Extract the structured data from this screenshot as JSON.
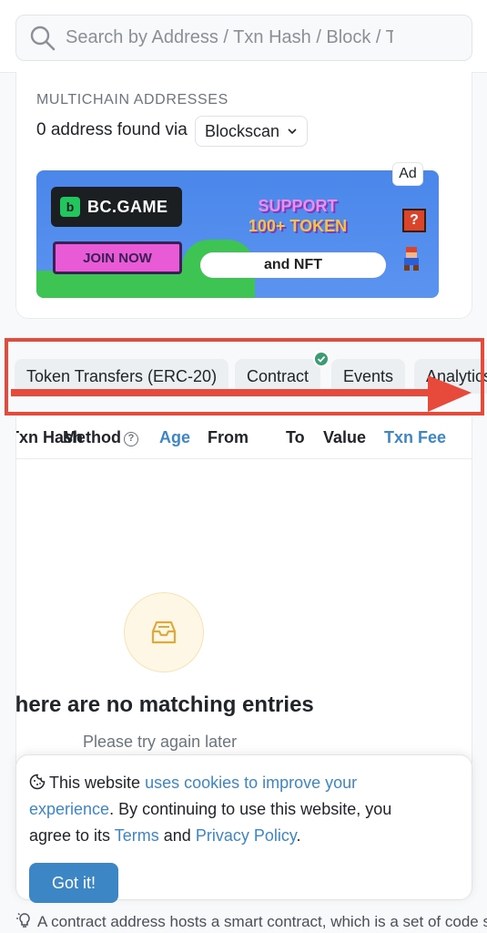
{
  "search": {
    "placeholder": "Search by Address / Txn Hash / Block / Token / Domain Name"
  },
  "multichain": {
    "label": "MULTICHAIN ADDRESSES",
    "found_text": "0 address found via",
    "select_value": "Blockscan"
  },
  "ad": {
    "badge": "Ad",
    "brand": "BC.GAME",
    "join": "JOIN NOW",
    "support_line1": "SUPPORT",
    "support_line2": "100+ TOKEN",
    "nft": "and NFT",
    "qblock": "?"
  },
  "tabs": {
    "items": [
      {
        "label": "Token Transfers (ERC-20)"
      },
      {
        "label": "Contract"
      },
      {
        "label": "Events"
      },
      {
        "label": "Analytics"
      }
    ]
  },
  "table": {
    "columns": [
      "Txn Hash",
      "Method",
      "Age",
      "From",
      "To",
      "Value",
      "Txn Fee"
    ],
    "empty_title": "There are no matching entries",
    "empty_subtitle": "Please try again later"
  },
  "cookie": {
    "prefix": "This website",
    "link1": "uses cookies to improve your experience",
    "middle": ". By continuing to use this website, you agree to its",
    "link2": "Terms",
    "and": "and",
    "link3": "Privacy Policy",
    "suffix": ".",
    "button": "Got it!"
  },
  "footnote": {
    "text": "A contract address hosts a smart contract, which is a set of code stored on the blockchain"
  },
  "colors": {
    "accent": "#3d86c6",
    "annotation_red": "#e7493a",
    "verified_green": "#3a9b74"
  }
}
